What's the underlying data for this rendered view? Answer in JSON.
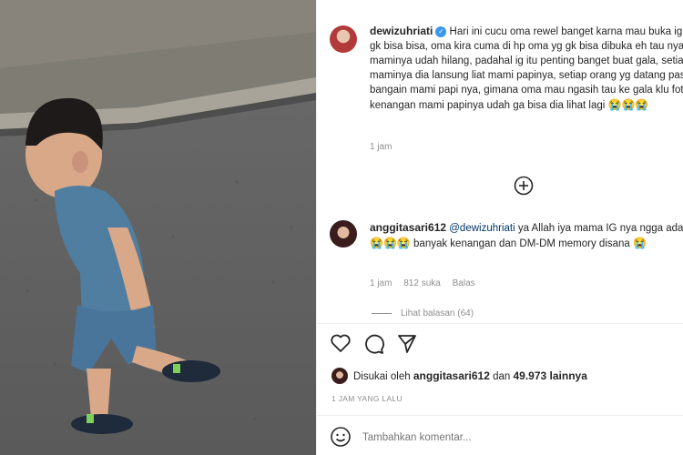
{
  "post": {
    "author": "dewizuhriati",
    "caption": "Hari ini cucu oma rewel banget karna mau buka ig maminya gk bisa bisa, oma kira cuma di hp oma yg gk bisa dibuka eh tau nya ig maminya udah hilang, padahal ig itu penting banget buat gala, setiap kangen maminya dia lansung liat mami papinya, setiap orang yg datang pasti di bangain mami papi nya, gimana oma mau ngasih tau ke gala klu foto kenangan mami papinya udah ga bisa dia lihat lagi",
    "caption_emojis": "😭😭😭",
    "time": "1 jam"
  },
  "load_more": {
    "icon": "plus-circle-icon"
  },
  "comment": {
    "author": "anggitasari612",
    "mention": "@dewizuhriati",
    "text_a": " ya Allah iya mama IG nya ngga ada ",
    "emojis_a": "😭😭😭",
    "text_b": " banyak kenangan dan DM-DM memory disana ",
    "emojis_b": "😭",
    "time": "1 jam",
    "likes": "812 suka",
    "reply": "Balas",
    "view_replies": "Lihat balasan (64)"
  },
  "actions": {
    "like_icon": "heart-icon",
    "comment_icon": "comment-icon",
    "share_icon": "send-icon"
  },
  "likes": {
    "prefix": "Disukai oleh",
    "user": "anggitasari612",
    "connector": "dan",
    "count": "49.973 lainnya"
  },
  "post_time": "1 JAM YANG LALU",
  "add_comment": {
    "placeholder": "Tambahkan komentar...",
    "emoji_icon": "smiley-icon"
  },
  "colors": {
    "verified": "#3897f0",
    "text": "#262626",
    "muted": "#8e8e8e",
    "mention": "#00376b"
  }
}
